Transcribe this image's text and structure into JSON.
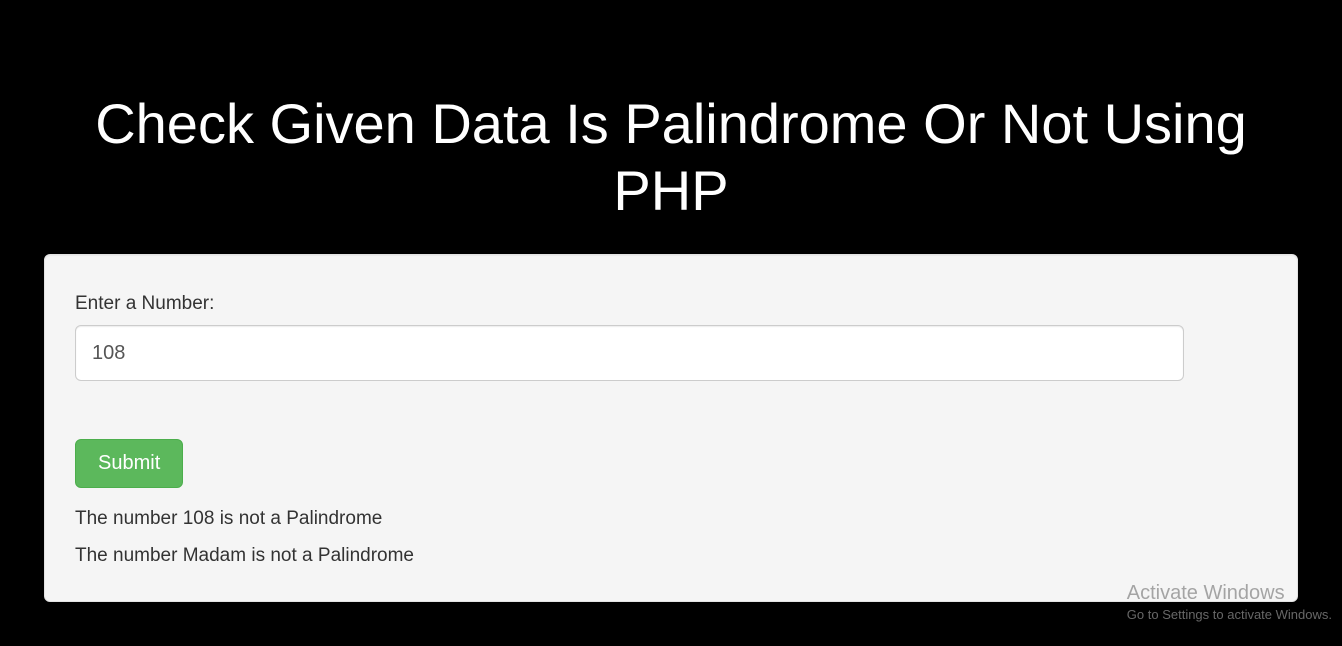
{
  "header": {
    "title": "Check Given Data Is Palindrome Or Not Using PHP"
  },
  "form": {
    "label": "Enter a Number:",
    "value": "108",
    "submit_label": "Submit"
  },
  "results": {
    "line1": "The number 108 is not a Palindrome",
    "line2": "The number Madam is not a Palindrome"
  },
  "watermark": {
    "title": "Activate Windows",
    "subtitle": "Go to Settings to activate Windows."
  }
}
